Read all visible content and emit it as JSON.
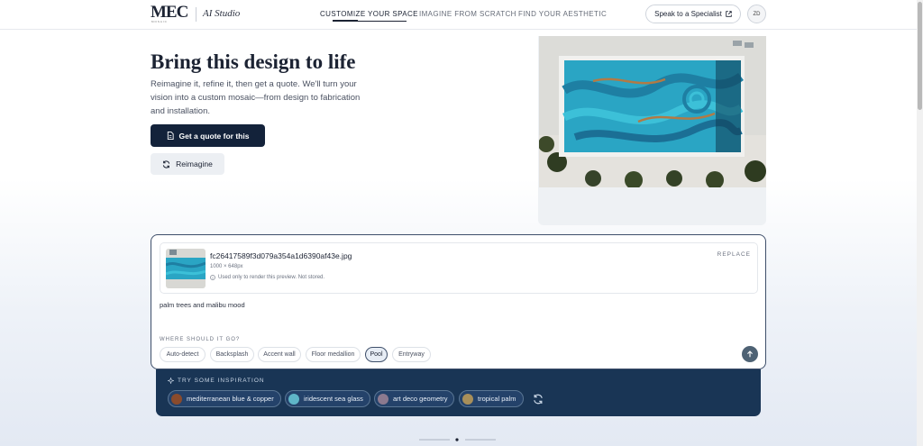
{
  "header": {
    "logo": "MEC",
    "logo_sub": "MOSAIC",
    "studio": "AI Studio",
    "nav": [
      "CUSTOMIZE YOUR SPACE",
      "IMAGINE FROM SCRATCH",
      "FIND YOUR AESTHETIC"
    ],
    "specialist_label": "Speak to a Specialist",
    "avatar_initials": "ZD"
  },
  "hero": {
    "title": "Bring this design to life",
    "description": "Reimagine it, refine it, then get a quote. We'll turn your vision into a custom mosaic—from design to fabrication and installation.",
    "quote_button": "Get a quote for this",
    "reimagine_button": "Reimagine"
  },
  "composer": {
    "file_name": "fc26417589f3d079a354a1d6390af43e.jpg",
    "file_dims": "1000 × 648px",
    "file_note": "Used only to render this preview. Not stored.",
    "replace_label": "REPLACE",
    "prompt": "palm trees and malibu mood",
    "where_label": "WHERE SHOULD IT GO?",
    "locations": [
      "Auto-detect",
      "Backsplash",
      "Accent wall",
      "Floor medallion",
      "Pool",
      "Entryway"
    ],
    "selected_location": "Pool"
  },
  "inspiration": {
    "label": "TRY SOME INSPIRATION",
    "chips": [
      {
        "label": "mediterranean blue & copper",
        "color": "#8a4b2c"
      },
      {
        "label": "iridescent sea glass",
        "color": "#5fb6c8"
      },
      {
        "label": "art deco geometry",
        "color": "#8c7a8f"
      },
      {
        "label": "tropical palm",
        "color": "#a88f5a"
      }
    ]
  },
  "colors": {
    "navy": "#13223a",
    "inspiration_bg": "#193555",
    "pool_water": "#2aa5c4"
  }
}
